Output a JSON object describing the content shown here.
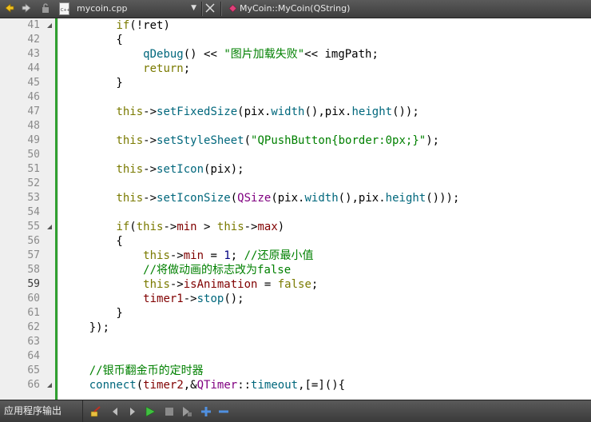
{
  "toolbar": {
    "file_name": "mycoin.cpp",
    "symbol": "MyCoin::MyCoin(QString)"
  },
  "editor": {
    "current_line": "59",
    "lines": [
      {
        "n": "41",
        "fold": true
      },
      {
        "n": "42"
      },
      {
        "n": "43"
      },
      {
        "n": "44"
      },
      {
        "n": "45"
      },
      {
        "n": "46"
      },
      {
        "n": "47"
      },
      {
        "n": "48"
      },
      {
        "n": "49"
      },
      {
        "n": "50"
      },
      {
        "n": "51"
      },
      {
        "n": "52"
      },
      {
        "n": "53"
      },
      {
        "n": "54"
      },
      {
        "n": "55",
        "fold": true
      },
      {
        "n": "56"
      },
      {
        "n": "57"
      },
      {
        "n": "58"
      },
      {
        "n": "59"
      },
      {
        "n": "60"
      },
      {
        "n": "61"
      },
      {
        "n": "62"
      },
      {
        "n": "63"
      },
      {
        "n": "64"
      },
      {
        "n": "65"
      },
      {
        "n": "66",
        "fold": true
      }
    ],
    "code": [
      [
        {
          "t": "        "
        },
        {
          "t": "if",
          "c": "kw"
        },
        {
          "t": "(!ret)"
        }
      ],
      [
        {
          "t": "        {"
        }
      ],
      [
        {
          "t": "            "
        },
        {
          "t": "qDebug",
          "c": "fn"
        },
        {
          "t": "() << "
        },
        {
          "t": "\"图片加载失败\"",
          "c": "str"
        },
        {
          "t": "<< imgPath;"
        }
      ],
      [
        {
          "t": "            "
        },
        {
          "t": "return",
          "c": "kw"
        },
        {
          "t": ";"
        }
      ],
      [
        {
          "t": "        }"
        }
      ],
      [
        {
          "t": ""
        }
      ],
      [
        {
          "t": "        "
        },
        {
          "t": "this",
          "c": "kw"
        },
        {
          "t": "->"
        },
        {
          "t": "setFixedSize",
          "c": "fn"
        },
        {
          "t": "(pix."
        },
        {
          "t": "width",
          "c": "fn"
        },
        {
          "t": "(),pix."
        },
        {
          "t": "height",
          "c": "fn"
        },
        {
          "t": "());"
        }
      ],
      [
        {
          "t": ""
        }
      ],
      [
        {
          "t": "        "
        },
        {
          "t": "this",
          "c": "kw"
        },
        {
          "t": "->"
        },
        {
          "t": "setStyleSheet",
          "c": "fn"
        },
        {
          "t": "("
        },
        {
          "t": "\"QPushButton{border:0px;}\"",
          "c": "str"
        },
        {
          "t": ");"
        }
      ],
      [
        {
          "t": ""
        }
      ],
      [
        {
          "t": "        "
        },
        {
          "t": "this",
          "c": "kw"
        },
        {
          "t": "->"
        },
        {
          "t": "setIcon",
          "c": "fn"
        },
        {
          "t": "(pix);"
        }
      ],
      [
        {
          "t": ""
        }
      ],
      [
        {
          "t": "        "
        },
        {
          "t": "this",
          "c": "kw"
        },
        {
          "t": "->"
        },
        {
          "t": "setIconSize",
          "c": "fn"
        },
        {
          "t": "("
        },
        {
          "t": "QSize",
          "c": "cls"
        },
        {
          "t": "(pix."
        },
        {
          "t": "width",
          "c": "fn"
        },
        {
          "t": "(),pix."
        },
        {
          "t": "height",
          "c": "fn"
        },
        {
          "t": "()));"
        }
      ],
      [
        {
          "t": ""
        }
      ],
      [
        {
          "t": "        "
        },
        {
          "t": "if",
          "c": "kw"
        },
        {
          "t": "("
        },
        {
          "t": "this",
          "c": "kw"
        },
        {
          "t": "->"
        },
        {
          "t": "min",
          "c": "mem"
        },
        {
          "t": " > "
        },
        {
          "t": "this",
          "c": "kw"
        },
        {
          "t": "->"
        },
        {
          "t": "max",
          "c": "mem"
        },
        {
          "t": ")"
        }
      ],
      [
        {
          "t": "        {"
        }
      ],
      [
        {
          "t": "            "
        },
        {
          "t": "this",
          "c": "kw"
        },
        {
          "t": "->"
        },
        {
          "t": "min",
          "c": "mem"
        },
        {
          "t": " = "
        },
        {
          "t": "1",
          "c": "num"
        },
        {
          "t": "; "
        },
        {
          "t": "//还原最小值",
          "c": "cm"
        }
      ],
      [
        {
          "t": "            "
        },
        {
          "t": "//将做动画的标志改为false",
          "c": "cm"
        }
      ],
      [
        {
          "t": "            "
        },
        {
          "t": "this",
          "c": "kw"
        },
        {
          "t": "->"
        },
        {
          "t": "isAnimation",
          "c": "mem"
        },
        {
          "t": " = "
        },
        {
          "t": "false",
          "c": "kw"
        },
        {
          "t": ";"
        }
      ],
      [
        {
          "t": "            "
        },
        {
          "t": "timer1",
          "c": "mem"
        },
        {
          "t": "->"
        },
        {
          "t": "stop",
          "c": "fn"
        },
        {
          "t": "();"
        }
      ],
      [
        {
          "t": "        }"
        }
      ],
      [
        {
          "t": "    });"
        }
      ],
      [
        {
          "t": ""
        }
      ],
      [
        {
          "t": ""
        }
      ],
      [
        {
          "t": "    "
        },
        {
          "t": "//银币翻金币的定时器",
          "c": "cm"
        }
      ],
      [
        {
          "t": "    "
        },
        {
          "t": "connect",
          "c": "fn"
        },
        {
          "t": "("
        },
        {
          "t": "timer2",
          "c": "mem"
        },
        {
          "t": ",&"
        },
        {
          "t": "QTimer",
          "c": "cls"
        },
        {
          "t": "::"
        },
        {
          "t": "timeout",
          "c": "fn"
        },
        {
          "t": ",[=](){"
        }
      ]
    ]
  },
  "bottombar": {
    "tab_label": "应用程序输出"
  },
  "colors": {
    "keyword": "#7a7a00",
    "function": "#00677c",
    "string": "#008000",
    "comment": "#008000",
    "number": "#000080",
    "member": "#800000",
    "class": "#800080",
    "modified_bar": "#30a030"
  }
}
